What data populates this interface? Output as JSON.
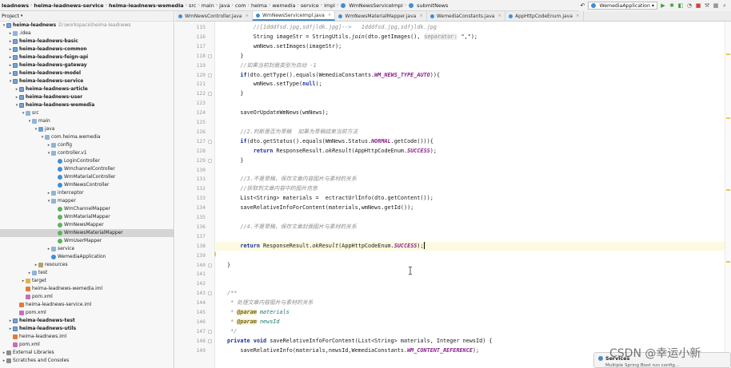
{
  "navbar": {
    "crumbs": [
      "leadnews",
      "heima-leadnews-service",
      "heima-leadnews-wemedia",
      "src",
      "main",
      "java",
      "com",
      "heima",
      "wemedia",
      "service",
      "impl",
      "WmNewsServiceImpl",
      "submitNews"
    ],
    "run_config": "WemediaApplication"
  },
  "project": {
    "header": "Project",
    "tree": [
      {
        "label": "heima-leadnews",
        "path": "D:\\workspace\\heima-leadnews",
        "depth": 0,
        "icon": "module",
        "arrow": "down",
        "bold": true
      },
      {
        "label": ".idea",
        "depth": 1,
        "icon": "folder",
        "arrow": "right"
      },
      {
        "label": "heima-leadnews-basic",
        "depth": 1,
        "icon": "module",
        "arrow": "right",
        "bold": true
      },
      {
        "label": "heima-leadnews-common",
        "depth": 1,
        "icon": "module",
        "arrow": "right",
        "bold": true
      },
      {
        "label": "heima-leadnews-feign-api",
        "depth": 1,
        "icon": "module",
        "arrow": "right",
        "bold": true
      },
      {
        "label": "heima-leadnews-gateway",
        "depth": 1,
        "icon": "module",
        "arrow": "right",
        "bold": true
      },
      {
        "label": "heima-leadnews-model",
        "depth": 1,
        "icon": "module",
        "arrow": "right",
        "bold": true
      },
      {
        "label": "heima-leadnews-service",
        "depth": 1,
        "icon": "module",
        "arrow": "down",
        "bold": true
      },
      {
        "label": "heima-leadnews-article",
        "depth": 2,
        "icon": "module",
        "arrow": "right",
        "bold": true
      },
      {
        "label": "heima-leadnews-user",
        "depth": 2,
        "icon": "module",
        "arrow": "right",
        "bold": true
      },
      {
        "label": "heima-leadnews-wemedia",
        "depth": 2,
        "icon": "module",
        "arrow": "down",
        "bold": true
      },
      {
        "label": "src",
        "depth": 3,
        "icon": "folder",
        "arrow": "down"
      },
      {
        "label": "main",
        "depth": 4,
        "icon": "folder",
        "arrow": "down"
      },
      {
        "label": "java",
        "depth": 5,
        "icon": "java-folder",
        "arrow": "down"
      },
      {
        "label": "com.heima.wemedia",
        "depth": 6,
        "icon": "folder",
        "arrow": "down"
      },
      {
        "label": "config",
        "depth": 7,
        "icon": "folder",
        "arrow": "right"
      },
      {
        "label": "controller.v1",
        "depth": 7,
        "icon": "folder",
        "arrow": "down"
      },
      {
        "label": "LoginController",
        "depth": 8,
        "icon": "class",
        "arrow": ""
      },
      {
        "label": "WmchannelController",
        "depth": 8,
        "icon": "class",
        "arrow": ""
      },
      {
        "label": "WmMaterialController",
        "depth": 8,
        "icon": "class",
        "arrow": ""
      },
      {
        "label": "WmNewsController",
        "depth": 8,
        "icon": "class",
        "arrow": ""
      },
      {
        "label": "interceptor",
        "depth": 7,
        "icon": "folder",
        "arrow": "right"
      },
      {
        "label": "mapper",
        "depth": 7,
        "icon": "folder",
        "arrow": "down"
      },
      {
        "label": "WmChannelMapper",
        "depth": 8,
        "icon": "iface",
        "arrow": ""
      },
      {
        "label": "WmMaterialMapper",
        "depth": 8,
        "icon": "iface",
        "arrow": ""
      },
      {
        "label": "WmNewsMapper",
        "depth": 8,
        "icon": "iface",
        "arrow": ""
      },
      {
        "label": "WmNewsMaterialMapper",
        "depth": 8,
        "icon": "iface",
        "arrow": "",
        "selected": true
      },
      {
        "label": "WmUserMapper",
        "depth": 8,
        "icon": "iface",
        "arrow": ""
      },
      {
        "label": "service",
        "depth": 7,
        "icon": "folder",
        "arrow": "right"
      },
      {
        "label": "WemediaApplication",
        "depth": 7,
        "icon": "app",
        "arrow": ""
      },
      {
        "label": "resources",
        "depth": 5,
        "icon": "res-folder",
        "arrow": "right"
      },
      {
        "label": "test",
        "depth": 4,
        "icon": "folder",
        "arrow": "right"
      },
      {
        "label": "target",
        "depth": 3,
        "icon": "target",
        "arrow": "right"
      },
      {
        "label": "heima-leadnews-wemedia.iml",
        "depth": 3,
        "icon": "xml",
        "arrow": ""
      },
      {
        "label": "pom.xml",
        "depth": 3,
        "icon": "maven",
        "arrow": ""
      },
      {
        "label": "heima-leadnews-service.iml",
        "depth": 2,
        "icon": "xml",
        "arrow": ""
      },
      {
        "label": "pom.xml",
        "depth": 2,
        "icon": "maven",
        "arrow": ""
      },
      {
        "label": "heima-leadnews-test",
        "depth": 1,
        "icon": "module",
        "arrow": "right",
        "bold": true
      },
      {
        "label": "heima-leadnews-utils",
        "depth": 1,
        "icon": "module",
        "arrow": "right",
        "bold": true
      },
      {
        "label": "heima-leadnews.iml",
        "depth": 1,
        "icon": "xml",
        "arrow": ""
      },
      {
        "label": "pom.xml",
        "depth": 1,
        "icon": "maven",
        "arrow": ""
      },
      {
        "label": "External Libraries",
        "depth": 0,
        "icon": "lib",
        "arrow": "right"
      },
      {
        "label": "Scratches and Consoles",
        "depth": 0,
        "icon": "lib",
        "arrow": "right"
      }
    ]
  },
  "tabs": [
    {
      "label": "WmNewsController.java",
      "active": false
    },
    {
      "label": "WmNewsServiceImpl.java",
      "active": true
    },
    {
      "label": "WmNewsMaterialMapper.java",
      "active": false
    },
    {
      "label": "WemediaConstants.java",
      "active": false
    },
    {
      "label": "AppHttpCodeEnum.java",
      "active": false
    }
  ],
  "editor": {
    "current_line": 138,
    "lines": [
      {
        "n": 115,
        "segs": [
          [
            "        ",
            ""
          ],
          [
            "//[1dddfsd.jpg,sdfjldk.jpg]-->   1dddfsd.jpg,sdfjldk.jpg",
            "cm"
          ]
        ]
      },
      {
        "n": 116,
        "segs": [
          [
            "        String imageStr = StringUtils.",
            ""
          ],
          [
            "join",
            "it"
          ],
          [
            "(dto.getImages(), ",
            ""
          ],
          [
            "separator:",
            "hint"
          ],
          [
            " \",\");",
            ""
          ]
        ]
      },
      {
        "n": 117,
        "segs": [
          [
            "        wmNews.setImages(imageStr);",
            ""
          ]
        ]
      },
      {
        "n": 118,
        "segs": [
          [
            "    }",
            ""
          ]
        ]
      },
      {
        "n": 119,
        "segs": [
          [
            "    ",
            ""
          ],
          [
            "//如果当前封面类型为自动 -1",
            "cm"
          ]
        ]
      },
      {
        "n": 120,
        "segs": [
          [
            "    ",
            ""
          ],
          [
            "if",
            "kw"
          ],
          [
            "(dto.getType().equals(WemediaConstants.",
            ""
          ],
          [
            "WM_NEWS_TYPE_AUTO",
            "cn"
          ],
          [
            ")){",
            ""
          ]
        ]
      },
      {
        "n": 121,
        "segs": [
          [
            "        wmNews.setType(",
            ""
          ],
          [
            "null",
            "kw"
          ],
          [
            ");",
            ""
          ]
        ]
      },
      {
        "n": 122,
        "segs": [
          [
            "    }",
            ""
          ]
        ]
      },
      {
        "n": 123,
        "segs": [
          [
            "",
            ""
          ]
        ]
      },
      {
        "n": 124,
        "segs": [
          [
            "    saveOrUpdateWmNews(wmNews);",
            ""
          ]
        ]
      },
      {
        "n": 125,
        "segs": [
          [
            "",
            ""
          ]
        ]
      },
      {
        "n": 126,
        "segs": [
          [
            "    ",
            ""
          ],
          [
            "//2.判断是否为草稿  如果为草稿结束当前方法",
            "cm"
          ]
        ]
      },
      {
        "n": 127,
        "segs": [
          [
            "    ",
            ""
          ],
          [
            "if",
            "kw"
          ],
          [
            "(dto.getStatus().equals(WmNews.Status.",
            ""
          ],
          [
            "NORMAL",
            "cn"
          ],
          [
            ".getCode())){",
            ""
          ]
        ]
      },
      {
        "n": 128,
        "segs": [
          [
            "        ",
            ""
          ],
          [
            "return",
            "kw"
          ],
          [
            " ResponseResult.",
            ""
          ],
          [
            "okResult",
            "it"
          ],
          [
            "(AppHttpCodeEnum.",
            ""
          ],
          [
            "SUCCESS",
            "cn"
          ],
          [
            ");",
            ""
          ]
        ]
      },
      {
        "n": 129,
        "segs": [
          [
            "    }",
            ""
          ]
        ]
      },
      {
        "n": 130,
        "segs": [
          [
            "",
            ""
          ]
        ]
      },
      {
        "n": 131,
        "segs": [
          [
            "    ",
            ""
          ],
          [
            "//3.不是草稿，保存文章内容图片与素材的关系",
            "cm"
          ]
        ]
      },
      {
        "n": 132,
        "segs": [
          [
            "    ",
            ""
          ],
          [
            "//获取到文章内容中的图片信息",
            "cm"
          ]
        ]
      },
      {
        "n": 133,
        "segs": [
          [
            "    List<String> materials =  ectractUrlInfo(dto.getContent());",
            ""
          ]
        ]
      },
      {
        "n": 134,
        "segs": [
          [
            "    saveRelativeInfoForContent(materials,wmNews.getId());",
            ""
          ]
        ]
      },
      {
        "n": 135,
        "segs": [
          [
            "",
            ""
          ]
        ]
      },
      {
        "n": 136,
        "segs": [
          [
            "    ",
            ""
          ],
          [
            "//4.不是草稿，保存文章封面图片与素材的关系",
            "cm"
          ]
        ]
      },
      {
        "n": 137,
        "segs": [
          [
            "",
            ""
          ]
        ]
      },
      {
        "n": 138,
        "segs": [
          [
            "    ",
            ""
          ],
          [
            "return",
            "kw"
          ],
          [
            " ResponseResult.",
            ""
          ],
          [
            "okResult",
            "it"
          ],
          [
            "(AppHttpCodeEnum.",
            ""
          ],
          [
            "SUCCESS",
            "cn"
          ],
          [
            ");",
            ""
          ]
        ]
      },
      {
        "n": 139,
        "segs": [
          [
            "",
            ""
          ]
        ]
      },
      {
        "n": 140,
        "segs": [
          [
            "}",
            ""
          ]
        ]
      },
      {
        "n": 141,
        "segs": [
          [
            "",
            ""
          ]
        ]
      },
      {
        "n": 142,
        "segs": [
          [
            "",
            ""
          ]
        ]
      },
      {
        "n": 143,
        "segs": [
          [
            "/**",
            "cm"
          ]
        ]
      },
      {
        "n": 144,
        "segs": [
          [
            " * 处理文章内容图片与素材的关系",
            "cm"
          ]
        ]
      },
      {
        "n": 145,
        "segs": [
          [
            " * ",
            "cm"
          ],
          [
            "@param",
            "tag"
          ],
          [
            " ",
            "cm"
          ],
          [
            "materials",
            "ptag"
          ]
        ]
      },
      {
        "n": 146,
        "segs": [
          [
            " * ",
            "cm"
          ],
          [
            "@param",
            "tag"
          ],
          [
            " ",
            "cm"
          ],
          [
            "newsId",
            "ptag"
          ]
        ]
      },
      {
        "n": 147,
        "segs": [
          [
            " */",
            "cm"
          ]
        ]
      },
      {
        "n": 148,
        "segs": [
          [
            "",
            ""
          ],
          [
            "private",
            "kw"
          ],
          [
            " ",
            ""
          ],
          [
            "void",
            "kw"
          ],
          [
            " saveRelativeInfoForContent(List<String> materials, Integer newsId) {",
            ""
          ]
        ]
      },
      {
        "n": 149,
        "segs": [
          [
            "    saveRelativeInfo(materials,newsId,WemediaConstants.",
            ""
          ],
          [
            "WM_CONTENT_REFERENCE",
            "cn"
          ],
          [
            ");",
            ""
          ]
        ]
      }
    ]
  },
  "services_popup": {
    "title": "Services",
    "body": "Multiple Spring Boot run config..."
  },
  "watermark": "CSDN @幸运小新",
  "colors": {
    "keyword": "#1b2fa0",
    "comment": "#8c8c8c",
    "constant": "#8a1f8a",
    "current_line": "#fcfae0",
    "selection": "#d5d5d5",
    "tab_accent": "#4a88c7"
  }
}
